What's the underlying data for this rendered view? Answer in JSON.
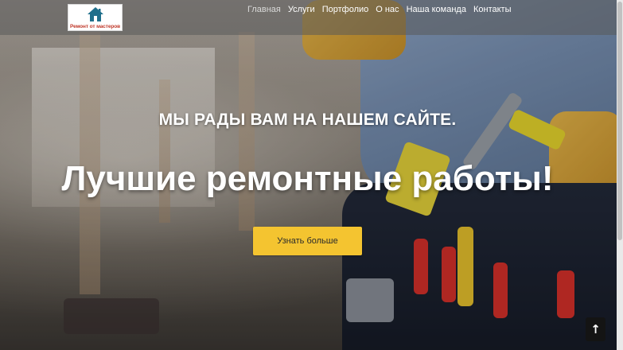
{
  "site": {
    "logo_text": "Ремонт от мастеров",
    "logo_icon": "house-icon"
  },
  "nav": {
    "items": [
      {
        "label": "Главная",
        "active": true
      },
      {
        "label": "Услуги",
        "active": false
      },
      {
        "label": "Портфолио",
        "active": false
      },
      {
        "label": "О нас",
        "active": false
      },
      {
        "label": "Наша команда",
        "active": false
      },
      {
        "label": "Контакты",
        "active": false
      }
    ]
  },
  "hero": {
    "subtitle": "МЫ РАДЫ ВАМ НА НАШЕМ САЙТЕ.",
    "title": "Лучшие ремонтные работы!",
    "cta_label": "Узнать больше"
  },
  "scroll_top": {
    "icon": "arrow-up-icon",
    "glyph": "↑"
  },
  "colors": {
    "accent": "#f4c430",
    "logo_text": "#c0392b",
    "logo_house": "#1f6f8b"
  }
}
